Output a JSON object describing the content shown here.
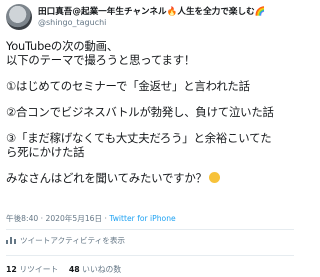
{
  "author": {
    "name": "田口真吾@起業一年生チャンネル🔥人生を全力で楽しむ🌈",
    "handle": "@shingo_taguchi"
  },
  "tweet": {
    "line1": "YouTubeの次の動画、",
    "line2": "以下のテーマで撮ろうと思ってます！",
    "item1": "①はじめてのセミナーで「金返せ」と言われた話",
    "item2": "②合コンでビジネスバトルが勃発し、負けて泣いた話",
    "item3a": "③「まだ稼げなくても大丈夫だろう」と余裕こいてた",
    "item3b": "ら死にかけた話",
    "closing": "みなさんはどれを聞いてみたいですか？"
  },
  "meta": {
    "timestamp": "午後8:40 · 2020年5月16日 · ",
    "source": "Twitter for iPhone"
  },
  "activity_label": "ツイートアクティビティを表示",
  "stats": {
    "retweets_count": "12",
    "retweets_label": " リツイート",
    "likes_count": "48",
    "likes_label": " いいねの数"
  },
  "icons": {
    "smile": "grinning-face-emoji",
    "activity": "bar-chart-icon"
  }
}
